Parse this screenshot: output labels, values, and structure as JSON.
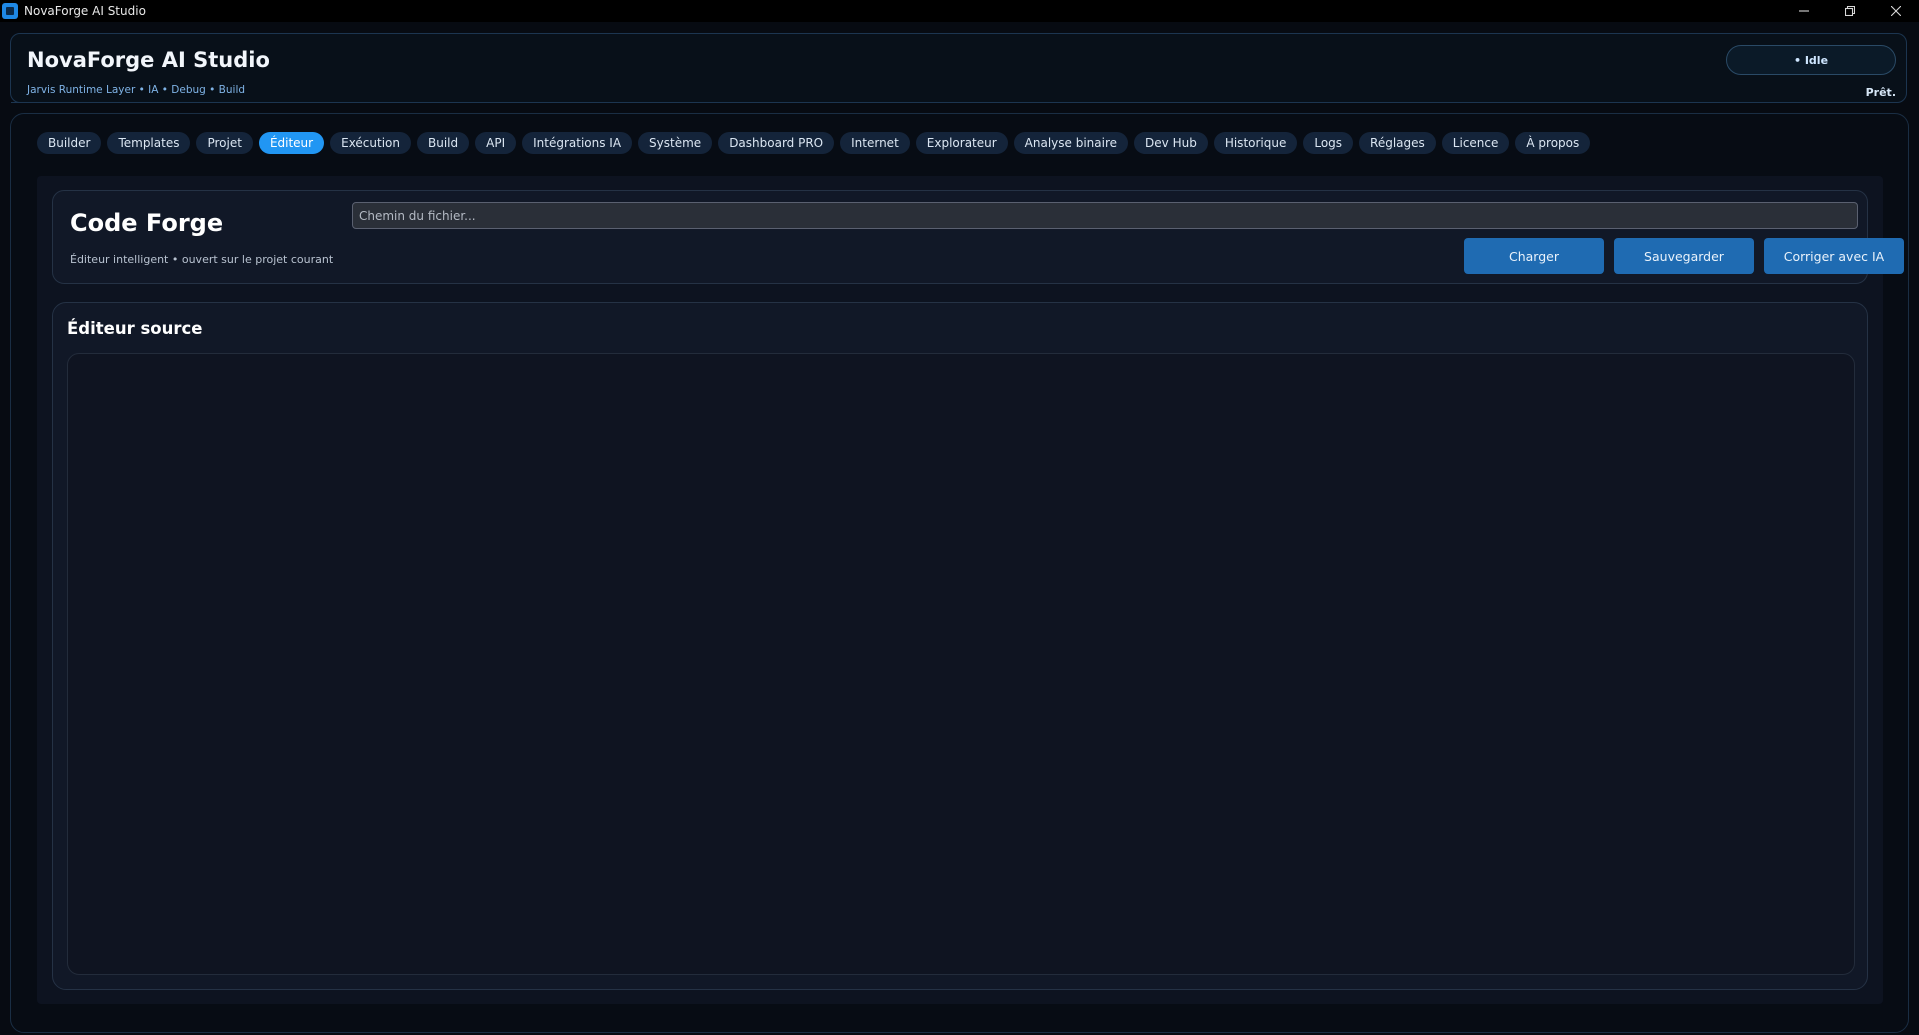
{
  "window": {
    "title": "NovaForge AI Studio",
    "controls": {
      "minimize": "–",
      "restore": "❐",
      "close": "✕"
    }
  },
  "header": {
    "title": "NovaForge AI Studio",
    "subtitle": "Jarvis Runtime Layer • IA • Debug • Build",
    "badge": "• Idle",
    "status": "Prêt."
  },
  "tabs": [
    {
      "label": "Builder",
      "active": false
    },
    {
      "label": "Templates",
      "active": false
    },
    {
      "label": "Projet",
      "active": false
    },
    {
      "label": "Éditeur",
      "active": true
    },
    {
      "label": "Exécution",
      "active": false
    },
    {
      "label": "Build",
      "active": false
    },
    {
      "label": "API",
      "active": false
    },
    {
      "label": "Intégrations IA",
      "active": false
    },
    {
      "label": "Système",
      "active": false
    },
    {
      "label": "Dashboard PRO",
      "active": false
    },
    {
      "label": "Internet",
      "active": false
    },
    {
      "label": "Explorateur",
      "active": false
    },
    {
      "label": "Analyse binaire",
      "active": false
    },
    {
      "label": "Dev Hub",
      "active": false
    },
    {
      "label": "Historique",
      "active": false
    },
    {
      "label": "Logs",
      "active": false
    },
    {
      "label": "Réglages",
      "active": false
    },
    {
      "label": "Licence",
      "active": false
    },
    {
      "label": "À propos",
      "active": false
    }
  ],
  "forge": {
    "title": "Code Forge",
    "subtitle": "Éditeur intelligent • ouvert sur le projet courant",
    "path_input": {
      "value": "",
      "placeholder": "Chemin du fichier..."
    },
    "buttons": {
      "load": "Charger",
      "save": "Sauvegarder",
      "fix": "Corriger avec IA"
    }
  },
  "editor": {
    "title": "Éditeur source",
    "content": ""
  },
  "colors": {
    "accent": "#2196f3",
    "button": "#1f6bb2",
    "background": "#070b12"
  }
}
